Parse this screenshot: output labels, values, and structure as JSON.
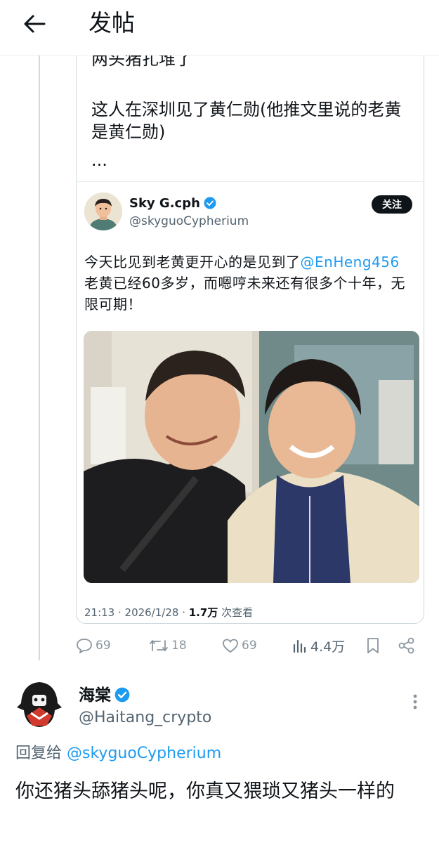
{
  "header": {
    "title": "发帖",
    "back_icon": "arrow-left-icon"
  },
  "quoted_post": {
    "line1": "两头猪扎堆了",
    "line2": "这人在深圳见了黄仁勋(他推文里说的老黄是黄仁勋)",
    "line3": "..."
  },
  "embedded_post": {
    "author_name": "Sky G.cph",
    "author_handle": "@skyguoCypherium",
    "follow_label": "关注",
    "text_before": "今天比见到老黄更开心的是见到了",
    "mention": "@EnHeng456",
    "text_after": " 老黄已经60多岁，而嗯哼未来还有很多个十年，无限可期！",
    "time": "21:13 · 2026/1/28 · ",
    "views_count": "1.7万",
    "views_label": " 次查看"
  },
  "actions": {
    "replies": "69",
    "retweets": "18",
    "likes": "69",
    "views": "4.4万"
  },
  "reply": {
    "author_name": "海棠",
    "author_handle": "@Haitang_crypto",
    "reply_to_label": "回复给 ",
    "reply_to_handle": "@skyguoCypherium",
    "text": "你还猪头舔猪头呢，你真又猥琐又猪头一样的"
  },
  "colors": {
    "accent": "#1d9bf0",
    "text": "#0f1419",
    "muted": "#536471",
    "border": "#cfd9de"
  }
}
